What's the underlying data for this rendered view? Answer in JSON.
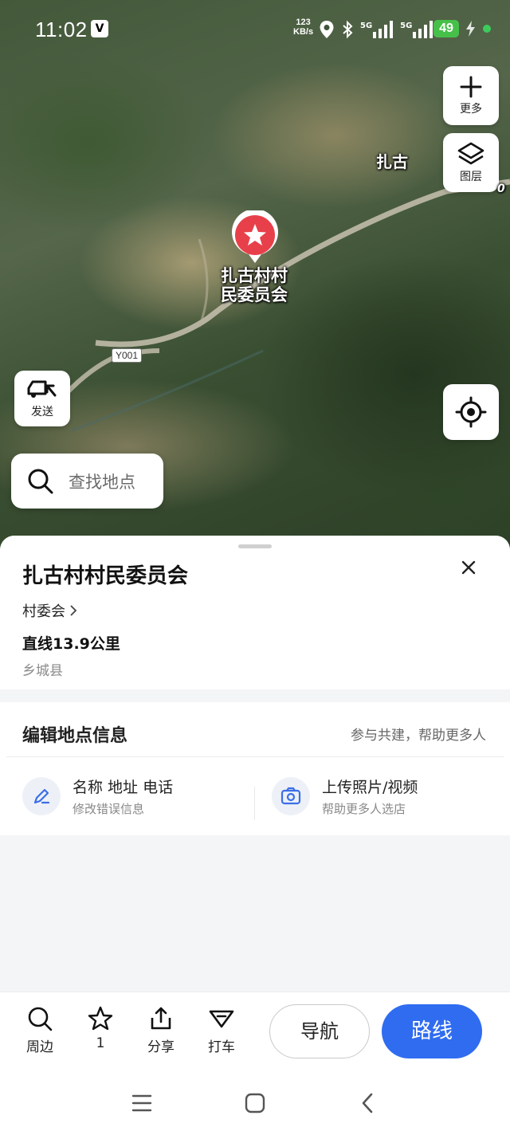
{
  "status_bar": {
    "time": "11:02",
    "vpn_icon": "V",
    "speed_value": "123",
    "speed_unit": "KB/s",
    "network1": "5G",
    "network2": "5G",
    "battery": "49"
  },
  "map": {
    "poi_label": "扎古村村民委员会",
    "place_label": "扎古",
    "place_suffix": "0",
    "road_badge": "Y001",
    "more_label": "更多",
    "layers_label": "图层",
    "send_label": "发送",
    "search_placeholder": "查找地点"
  },
  "poi": {
    "title": "扎古村村民委员会",
    "category": "村委会",
    "distance": "直线13.9公里",
    "region": "乡城县"
  },
  "edit": {
    "title": "编辑地点信息",
    "subtitle": "参与共建，帮助更多人",
    "item1_title": "名称 地址 电话",
    "item1_sub": "修改错误信息",
    "item2_title": "上传照片/视频",
    "item2_sub": "帮助更多人选店"
  },
  "actions": {
    "nearby": "周边",
    "favorite_count": "1",
    "share": "分享",
    "taxi": "打车",
    "navigate": "导航",
    "route": "路线"
  },
  "colors": {
    "accent": "#2f6cf0",
    "pin": "#e8404a"
  }
}
